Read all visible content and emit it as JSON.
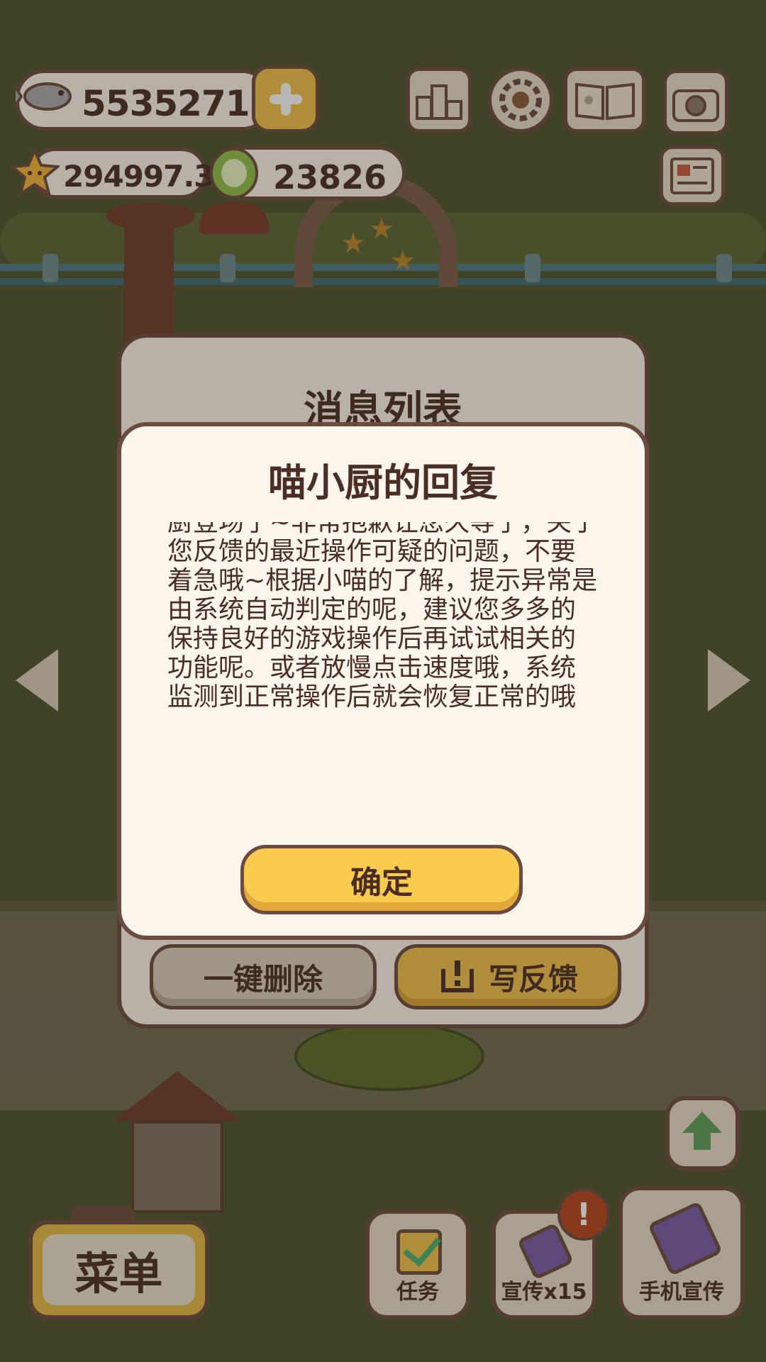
{
  "hud": {
    "fish_count": "5535271",
    "star_count": "294997.3",
    "coin_count": "23826",
    "rank_icon": "podium-rank-icon",
    "settings_icon": "gear-icon",
    "guide_icon": "book-icon",
    "camera_icon": "camera-icon",
    "news_icon": "newspaper-icon"
  },
  "message_list": {
    "title": "消息列表",
    "delete_all_label": "一键删除",
    "feedback_label": "写反馈"
  },
  "reply_dialog": {
    "title": "喵小厨的回复",
    "body": "厨登场了~非常抱歉让您久等了，关于您反馈的最近操作可疑的问题，不要着急哦~根据小喵的了解，提示异常是由系统自动判定的呢，建议您多多的保持良好的游戏操作后再试试相关的功能呢。或者放慢点击速度哦，系统监测到正常操作后就会恢复正常的哦",
    "confirm_label": "确定"
  },
  "bottom_bar": {
    "menu_label": "菜单",
    "task_label": "任务",
    "promo_label": "宣传x15",
    "phone_promo_label": "手机宣传",
    "alert_badge": "!"
  },
  "colors": {
    "panel_bg": "#fbf5ec",
    "border": "#6b4a3f",
    "accent_yellow": "#f9cc50",
    "text_dark": "#4a2e25",
    "alert_red": "#b4441e"
  }
}
